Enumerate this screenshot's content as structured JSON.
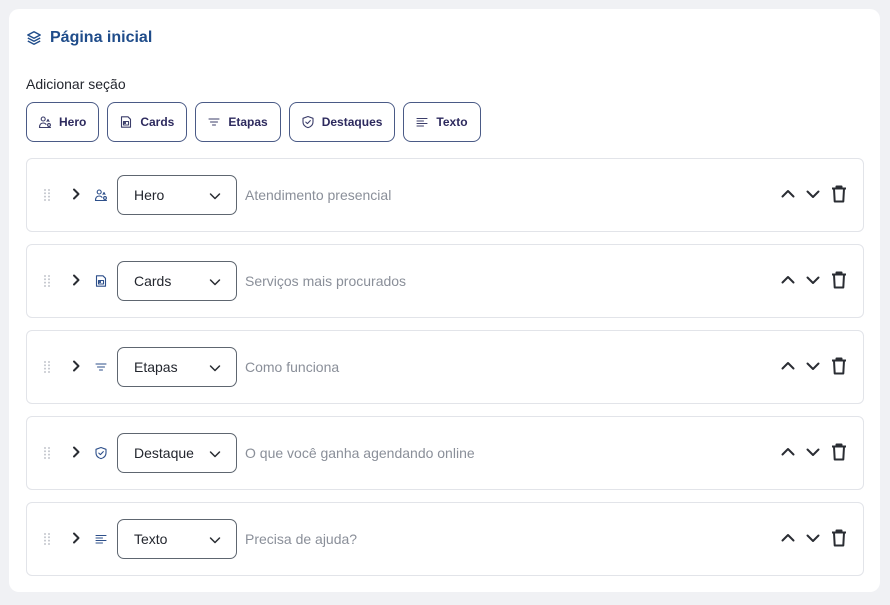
{
  "header": {
    "title": "Página inicial",
    "icon": "layers-icon",
    "color": "#1f4c8a"
  },
  "add_section": {
    "label": "Adicionar seção",
    "buttons": [
      {
        "label": "Hero",
        "icon": "hero-icon"
      },
      {
        "label": "Cards",
        "icon": "cards-icon"
      },
      {
        "label": "Etapas",
        "icon": "steps-icon"
      },
      {
        "label": "Destaques",
        "icon": "highlights-icon"
      },
      {
        "label": "Texto",
        "icon": "text-icon"
      }
    ]
  },
  "sections": [
    {
      "type": "Hero",
      "icon": "hero-icon",
      "title": "Atendimento presencial"
    },
    {
      "type": "Cards",
      "icon": "cards-icon",
      "title": "Serviços mais procurados"
    },
    {
      "type": "Etapas",
      "icon": "steps-icon",
      "title": "Como funciona"
    },
    {
      "type": "Destaque",
      "icon": "highlights-icon",
      "title": "O que você ganha agendando online"
    },
    {
      "type": "Texto",
      "icon": "text-icon",
      "title": "Precisa de ajuda?"
    }
  ],
  "colors": {
    "accent": "#1f4c8a",
    "button_border": "#4a5a86",
    "placeholder_text": "#8a8f99"
  }
}
